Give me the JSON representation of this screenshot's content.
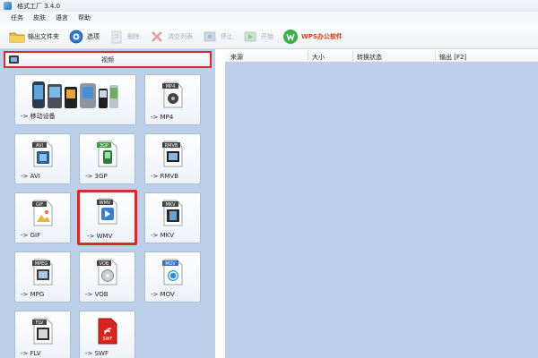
{
  "app": {
    "title": "格式工厂 3.4.0"
  },
  "menu": [
    "任务",
    "皮肤",
    "语言",
    "帮助"
  ],
  "toolbar": [
    {
      "label": "输出文件夹",
      "enabled": true,
      "icon": "folder-icon"
    },
    {
      "label": "选项",
      "enabled": true,
      "icon": "options-icon"
    },
    {
      "label": "删除",
      "enabled": false,
      "icon": "delete-icon"
    },
    {
      "label": "清空列表",
      "enabled": false,
      "icon": "clear-list-icon"
    },
    {
      "label": "停止",
      "enabled": false,
      "icon": "stop-icon"
    },
    {
      "label": "开始",
      "enabled": false,
      "icon": "start-icon"
    },
    {
      "label": "WPS办公软件",
      "enabled": true,
      "icon": "wps-icon"
    }
  ],
  "sidebar": {
    "category": "视频",
    "tiles": [
      {
        "label": "-> 移动设备",
        "badge": ""
      },
      {
        "label": "-> MP4",
        "badge": "MP4"
      },
      {
        "label": "-> AVI",
        "badge": "AVI"
      },
      {
        "label": "-> 3GP",
        "badge": "3GP"
      },
      {
        "label": "-> RMVB",
        "badge": "RMVB"
      },
      {
        "label": "-> GIF",
        "badge": "GIF"
      },
      {
        "label": "-> WMV",
        "badge": "WMV"
      },
      {
        "label": "-> MKV",
        "badge": "MKV"
      },
      {
        "label": "-> MPG",
        "badge": "MPEG"
      },
      {
        "label": "-> VOB",
        "badge": "VOB"
      },
      {
        "label": "-> MOV",
        "badge": "MOV"
      },
      {
        "label": "-> FLV",
        "badge": "FLV"
      },
      {
        "label": "-> SWF",
        "badge": "SWF"
      }
    ]
  },
  "list": {
    "columns": [
      "来源",
      "大小",
      "转换状态",
      "输出 [F2]"
    ]
  },
  "colors": {
    "highlight": "#d62b2b",
    "panel": "#bcd0ea"
  }
}
